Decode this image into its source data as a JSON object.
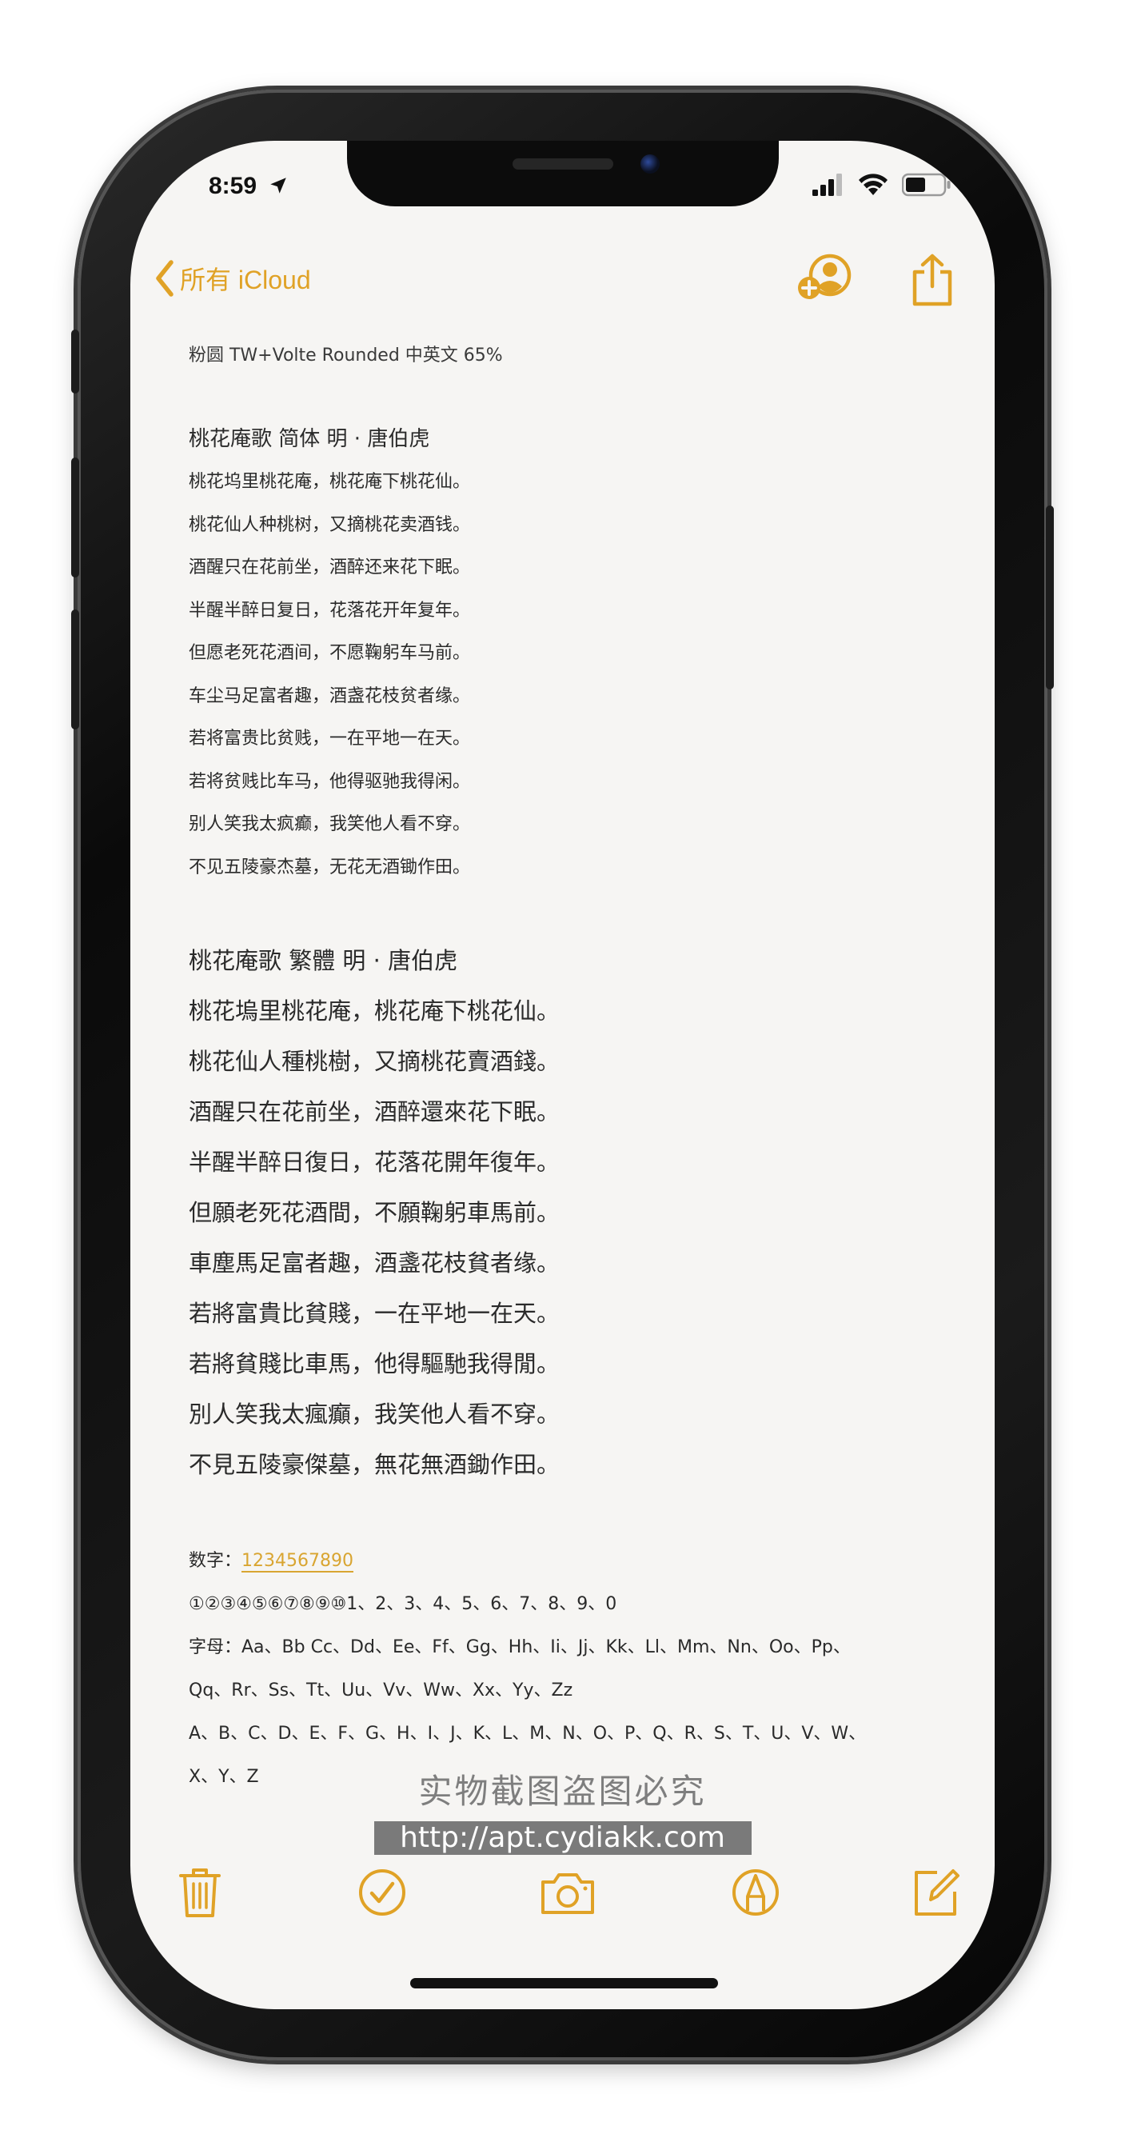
{
  "status_bar": {
    "time": "8:59"
  },
  "nav": {
    "back_label": "所有 iCloud"
  },
  "note": {
    "font_line": "粉圆 TW+Volte Rounded 中英文 65%",
    "simplified": {
      "title": "桃花庵歌 简体  明 · 唐伯虎",
      "lines": [
        "桃花坞里桃花庵，桃花庵下桃花仙。",
        "桃花仙人种桃树，又摘桃花卖酒钱。",
        "酒醒只在花前坐，酒醉还来花下眠。",
        "半醒半醉日复日，花落花开年复年。",
        "但愿老死花酒间，不愿鞠躬车马前。",
        "车尘马足富者趣，酒盏花枝贫者缘。",
        "若将富贵比贫贱，一在平地一在天。",
        "若将贫贱比车马，他得驱驰我得闲。",
        "别人笑我太疯癫，我笑他人看不穿。",
        "不见五陵豪杰墓，无花无酒锄作田。"
      ]
    },
    "traditional": {
      "title": "桃花庵歌 繁體    明 · 唐伯虎",
      "lines": [
        "桃花塢里桃花庵，桃花庵下桃花仙。",
        "桃花仙人種桃樹，又摘桃花賣酒錢。",
        "酒醒只在花前坐，酒醉還來花下眠。",
        "半醒半醉日復日，花落花開年復年。",
        "但願老死花酒間，不願鞠躬車馬前。",
        "車塵馬足富者趣，酒盞花枝貧者缘。",
        "若將富貴比貧賤，一在平地一在天。",
        "若將貧賤比車馬，他得驅馳我得閒。",
        "別人笑我太瘋癲，我笑他人看不穿。",
        "不見五陵豪傑墓，無花無酒鋤作田。"
      ]
    },
    "misc": {
      "digits_label": "数字：",
      "digits_value": "1234567890",
      "circled": "①②③④⑤⑥⑦⑧⑨⑩1、2、3、4、5、6、7、8、9、0",
      "letters_line1": "字母：Aa、Bb Cc、Dd、Ee、Ff、Gg、Hh、Ii、Jj、Kk、Ll、Mm、Nn、Oo、Pp、",
      "letters_line2": "Qq、Rr、Ss、Tt、Uu、Vv、Ww、Xx、Yy、Zz",
      "caps_line1": "A、B、C、D、E、F、G、H、I、J、K、L、M、N、O、P、Q、R、S、T、U、V、W、",
      "caps_line2": "X、Y、Z"
    }
  },
  "watermark": {
    "title": "实物截图盗图必究",
    "url": "http://apt.cydiakk.com"
  },
  "toolbar": {
    "icons": [
      "trash-icon",
      "checklist-icon",
      "camera-icon",
      "markup-icon",
      "compose-icon"
    ]
  },
  "colors": {
    "accent": "#e0a226",
    "background": "#f6f5f3",
    "text": "#2a2a2a"
  }
}
